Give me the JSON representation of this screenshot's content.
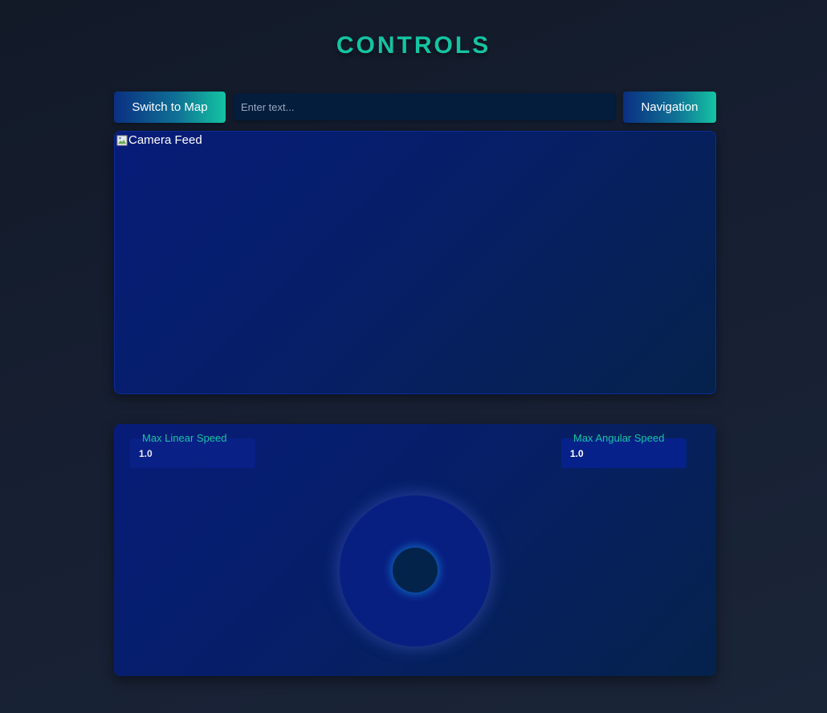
{
  "header": {
    "title": "CONTROLS"
  },
  "toolbar": {
    "switch_label": "Switch to Map",
    "text_placeholder": "Enter text...",
    "navigation_label": "Navigation"
  },
  "camera": {
    "alt_text": "Camera Feed",
    "icon": "broken-image-icon"
  },
  "speeds": {
    "linear_label": "Max Linear Speed",
    "linear_value": "1.0",
    "angular_label": "Max Angular Speed",
    "angular_value": "1.0"
  },
  "joystick": {
    "icon": "joystick"
  },
  "colors": {
    "accent": "#14c4a2",
    "panel": "#071c78",
    "background": "#121a28",
    "button_gradient_start": "#0b2f82",
    "button_gradient_end": "#14c4a2"
  }
}
